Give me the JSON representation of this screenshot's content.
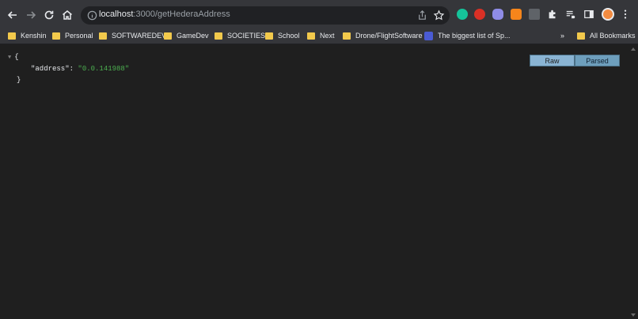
{
  "address_bar": {
    "host": "localhost",
    "path": ":3000/getHederaAddress"
  },
  "bookmarks": [
    {
      "label": "Kenshin",
      "type": "folder"
    },
    {
      "label": "Personal",
      "type": "folder"
    },
    {
      "label": "SOFTWAREDEV",
      "type": "folder"
    },
    {
      "label": "GameDev",
      "type": "folder"
    },
    {
      "label": "SOCIETIES",
      "type": "folder"
    },
    {
      "label": "School",
      "type": "folder"
    },
    {
      "label": "Next",
      "type": "folder"
    },
    {
      "label": "Drone/FlightSoftware",
      "type": "folder"
    },
    {
      "label": "The biggest list of Sp...",
      "type": "link"
    }
  ],
  "bookmarks_overflow": "»",
  "all_bookmarks": "All Bookmarks",
  "json_view": {
    "open_brace": "{",
    "key": "\"address\"",
    "colon": ": ",
    "value": "\"0.0.141988\"",
    "close_brace": "}"
  },
  "view_modes": {
    "raw": "Raw",
    "parsed": "Parsed",
    "selected": "Parsed"
  },
  "colors": {
    "toolbar": "#35363a",
    "page_background": "#1f1f1f",
    "json_string": "#4caf50",
    "button": "#8ab4d3"
  }
}
